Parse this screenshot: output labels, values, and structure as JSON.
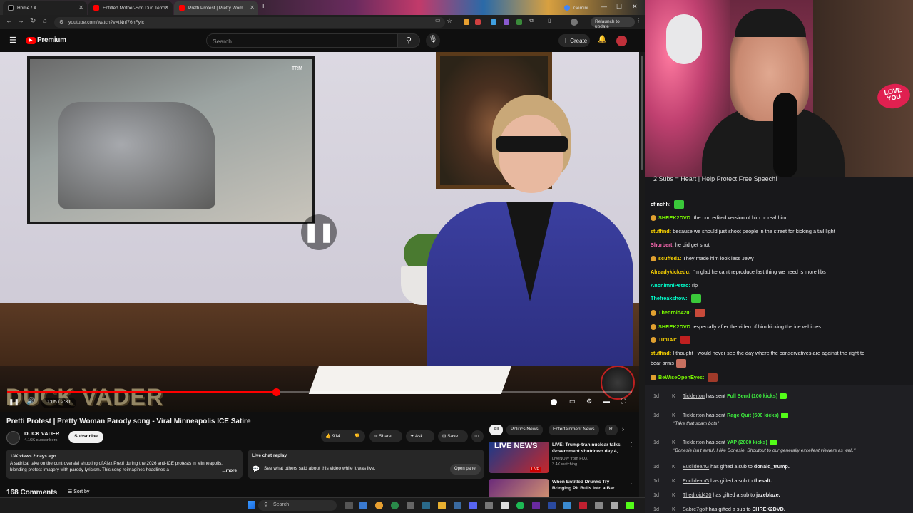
{
  "browser": {
    "tabs": [
      {
        "label": "Home / X",
        "color": "#000000"
      },
      {
        "label": "Entitled Mother-Son Duo Terro",
        "color": "#ff0000"
      },
      {
        "label": "Pretti Protest | Pretty Wom",
        "color": "#ff0000"
      },
      {
        "label": "Gemini",
        "color": "#4285f4"
      }
    ],
    "url": "youtube.com/watch?v=tNnf76hFylc",
    "relaunch_label": "Relaunch to update"
  },
  "youtube": {
    "logo": "Premium",
    "search_placeholder": "Search",
    "create_label": "Create"
  },
  "player": {
    "watermark": "DUCK VADER",
    "time": "1:05 / 2:31",
    "progress": 0.43,
    "tv_logo": "TRM"
  },
  "video": {
    "title": "Pretti Protest | Pretty Woman Parody song - Viral Minneapolis ICE Satire",
    "channel": "DUCK VADER",
    "subscribers": "4.16K subscribers",
    "subscribe_label": "Subscribe",
    "likes": "914",
    "share_label": "Share",
    "ask_label": "Ask",
    "save_label": "Save",
    "views_date": "13K views  2 days ago",
    "description": "A satirical take on the controversial shooting of Alex Pretti during the 2026 anti-ICE protests in Minneapolis, blending protest imagery with parody lyricism. This song reimagines headlines a",
    "more_label": "...more",
    "live_chat_title": "Live chat replay",
    "live_chat_text": "See what others said about this video while it was live.",
    "open_panel_label": "Open panel",
    "comments_count": "168 Comments",
    "sort_label": "Sort by"
  },
  "sidebar": {
    "chips": [
      "All",
      "Politics News",
      "Entertainment News",
      "R"
    ],
    "recs": [
      {
        "thumb_text": "LIVE NEWS",
        "title": "LIVE: Trump-tran nuclear talks, Government shutdown day 4, ...",
        "channel": "LiveNOW from FOX",
        "meta": "3.4K watching",
        "badge": "LIVE"
      },
      {
        "thumb_text": "",
        "title": "When Entitled Drunks Try Bringing Pit Bulls into a Bar",
        "channel": "",
        "meta": "",
        "badge": ""
      }
    ]
  },
  "taskbar": {
    "search_placeholder": "Search"
  },
  "webcam": {
    "sign_text": "LOVE YOU"
  },
  "chat": {
    "title": "2 Subs = Heart | Help Protect Free Speech!",
    "messages": [
      {
        "user": "cfinchh:",
        "text": "",
        "color": "#ffffff",
        "emote": true,
        "badge": false
      },
      {
        "user": "SHREK2DVD:",
        "text": "the cnn edited version of him or real him",
        "color": "#7cfc00",
        "emote": false,
        "badge": true
      },
      {
        "user": "stuffind:",
        "text": "because we should just shoot people in the street for kicking a tail light",
        "color": "#ffd700",
        "emote": false,
        "badge": false
      },
      {
        "user": "Shurbert:",
        "text": "he did get shot",
        "color": "#ff69b4",
        "emote": false,
        "badge": false
      },
      {
        "user": "scuffed1:",
        "text": "They made him look less Jewy",
        "color": "#ffd700",
        "emote": false,
        "badge": true
      },
      {
        "user": "Alreadykickedu:",
        "text": "I'm glad he can't reproduce last thing we need is more libs",
        "color": "#ffd700",
        "emote": false,
        "badge": false
      },
      {
        "user": "AnonimniPetao:",
        "text": "rip",
        "color": "#00ffcc",
        "emote": false,
        "badge": false
      },
      {
        "user": "Thefreakshow:",
        "text": "",
        "color": "#00ffcc",
        "emote": true,
        "badge": false
      },
      {
        "user": "Thedroid420:",
        "text": "",
        "color": "#7cfc00",
        "emote": true,
        "badge": true
      },
      {
        "user": "SHREK2DVD:",
        "text": "especially after the video of him kicking the ice vehicles",
        "color": "#7cfc00",
        "emote": false,
        "badge": true
      },
      {
        "user": "TutuAT:",
        "text": "",
        "color": "#ffd700",
        "emote": true,
        "badge": true
      },
      {
        "user": "stuffind:",
        "text": "I thought I would never see the day where the conservatives are against the right to",
        "color": "#ffd700",
        "emote": false,
        "badge": false
      },
      {
        "user": "",
        "text": "bear arms",
        "color": "#ffffff",
        "emote": true,
        "badge": false
      },
      {
        "user": "BeWiseOpenEyes:",
        "text": "",
        "color": "#7cfc00",
        "emote": true,
        "badge": true
      }
    ],
    "events": [
      {
        "time": "1d",
        "name": "Ticklerton",
        "text": " has sent ",
        "highlight": "Full Send (100 kicks)",
        "quote": ""
      },
      {
        "time": "1d",
        "name": "Ticklerton",
        "text": " has sent ",
        "highlight": "Rage Quit (500 kicks)",
        "quote": "\"Take that spam bots\""
      },
      {
        "time": "1d",
        "name": "Ticklerton",
        "text": " has sent ",
        "highlight": "YAP (2000 kicks)",
        "quote": "\"Bonesie isn't awful. I like Bonesie. Shoutout to our generally excellent viewers as well.\""
      },
      {
        "time": "1d",
        "name": "EuclideanG",
        "text": " has gifted a sub to ",
        "highlight": "donald_trump.",
        "quote": ""
      },
      {
        "time": "1d",
        "name": "EuclideanG",
        "text": " has gifted a sub to ",
        "highlight": "thesalt.",
        "quote": ""
      },
      {
        "time": "1d",
        "name": "Thedroid420",
        "text": " has gifted a sub to ",
        "highlight": "jazeblaze.",
        "quote": ""
      },
      {
        "time": "1d",
        "name": "Sabre7golf",
        "text": " has gifted a sub to ",
        "highlight": "SHREK2DVD.",
        "quote": ""
      }
    ]
  },
  "colors": {
    "youtube_red": "#ff0000",
    "kick_green": "#53fc18",
    "chat_bg": "#18181b"
  }
}
